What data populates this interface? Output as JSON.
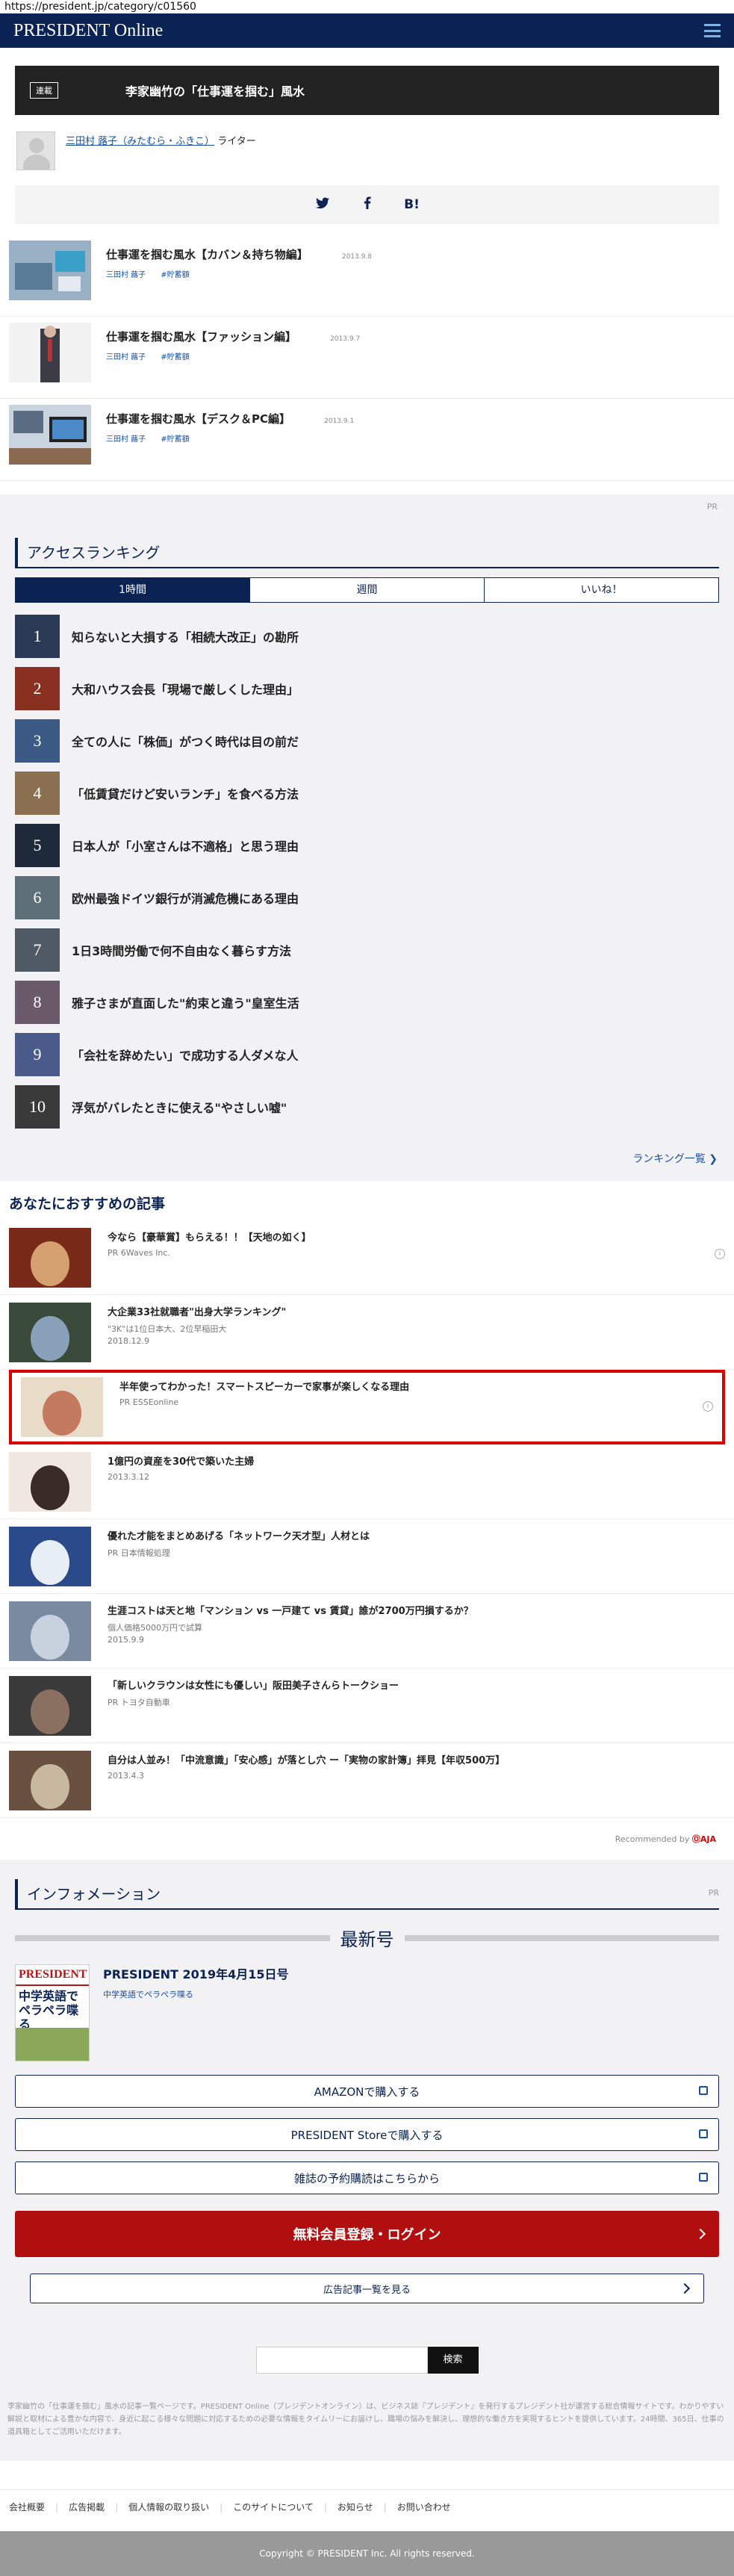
{
  "url": "https://president.jp/category/c01560",
  "header": {
    "logo": "PRESIDENT Online"
  },
  "serial": {
    "badge": "連載",
    "title": "李家幽竹の「仕事運を掴む」風水"
  },
  "author": {
    "name": "三田村 蕗子（みたむら・ふきこ）",
    "role": "ライター"
  },
  "share": {
    "twitter": "twitter-icon",
    "facebook": "facebook-icon",
    "hatena": "B!"
  },
  "related": [
    {
      "title": "仕事運を掴む風水【カバン＆持ち物編】",
      "date": "2013.9.8",
      "author": "三田村 蕗子",
      "tag": "#貯蓄額",
      "colors": [
        "#9ab0c4",
        "#5b7c99"
      ]
    },
    {
      "title": "仕事運を掴む風水【ファッション編】",
      "date": "2013.9.7",
      "author": "三田村 蕗子",
      "tag": "#貯蓄額",
      "colors": [
        "#e8e8e8",
        "#3c3c46"
      ]
    },
    {
      "title": "仕事運を掴む風水【デスク＆PC編】",
      "date": "2013.9.1",
      "author": "三田村 蕗子",
      "tag": "#貯蓄額",
      "colors": [
        "#5a6b82",
        "#c9d4df"
      ]
    }
  ],
  "pr_label": "PR",
  "ranking": {
    "title": "アクセスランキング",
    "tabs": [
      "1時間",
      "週間",
      "いいね！"
    ],
    "items": [
      {
        "rank": "1",
        "title": "知らないと大損する「相続大改正」の勘所",
        "color": "#2a3a55"
      },
      {
        "rank": "2",
        "title": "大和ハウス会長「現場で厳しくした理由」",
        "color": "#8a3020"
      },
      {
        "rank": "3",
        "title": "全ての人に「株価」がつく時代は目の前だ",
        "color": "#3c5a86"
      },
      {
        "rank": "4",
        "title": "「低賃貸だけど安いランチ」を食べる方法",
        "color": "#8a7050"
      },
      {
        "rank": "5",
        "title": "日本人が「小室さんは不適格」と思う理由",
        "color": "#1e2a3a"
      },
      {
        "rank": "6",
        "title": "欧州最強ドイツ銀行が消滅危機にある理由",
        "color": "#5f6f7a"
      },
      {
        "rank": "7",
        "title": "1日3時間労働で何不自由なく暮らす方法",
        "color": "#505a64"
      },
      {
        "rank": "8",
        "title": "雅子さまが直面した\"約束と違う\"皇室生活",
        "color": "#6b5a6a"
      },
      {
        "rank": "9",
        "title": "「会社を辞めたい」で成功する人ダメな人",
        "color": "#4a5a8a"
      },
      {
        "rank": "10",
        "title": "浮気がバレたときに使える\"やさしい嘘\"",
        "color": "#3a3a3a"
      }
    ],
    "more": "ランキング一覧 ❯"
  },
  "recommend": {
    "title": "あなたにおすすめの記事",
    "items": [
      {
        "title": "今なら【豪華賞】もらえる！！【天地の如く】",
        "sub": "PR 6Waves Inc.",
        "info": true,
        "highlight": false,
        "colors": [
          "#7a2a18",
          "#d4a070"
        ]
      },
      {
        "title": "大企業33社就職者\"出身大学ランキング\"",
        "sub": "\"3K\"は1位日本大、2位早稲田大",
        "sub2": "2018.12.9",
        "info": false,
        "highlight": false,
        "colors": [
          "#3a4a3a",
          "#88a0b8"
        ]
      },
      {
        "title": "半年使ってわかった！スマートスピーカーで家事が楽しくなる理由",
        "sub": "PR ESSEonline",
        "info": true,
        "highlight": true,
        "colors": [
          "#e8dcc8",
          "#c47a60"
        ]
      },
      {
        "title": "1億円の資産を30代で築いた主婦",
        "sub": "2013.3.12",
        "info": false,
        "highlight": false,
        "colors": [
          "#f0e8e0",
          "#3a2a28"
        ]
      },
      {
        "title": "優れた才能をまとめあげる「ネットワーク天才型」人材とは",
        "sub": "PR 日本情報処理",
        "info": false,
        "highlight": false,
        "colors": [
          "#2a4a8a",
          "#e8eef6"
        ]
      },
      {
        "title": "生涯コストは天と地「マンション vs 一戸建て vs 賃貸」誰が2700万円損するか？",
        "sub": "個人価格5000万円で試算",
        "sub2": "2015.9.9",
        "info": false,
        "highlight": false,
        "colors": [
          "#7a8aa0",
          "#c8d2de"
        ]
      },
      {
        "title": "「新しいクラウンは女性にも優しい」阪田美子さんらトークショー",
        "sub": "PR トヨタ自動車",
        "info": false,
        "highlight": false,
        "colors": [
          "#3a3a3a",
          "#8a7060"
        ]
      },
      {
        "title": "自分は人並み！「中流意識」「安心感」が落とし穴 ー「実物の家計簿」拝見【年収500万】",
        "sub": "2013.4.3",
        "info": false,
        "highlight": false,
        "colors": [
          "#6a5040",
          "#c8b8a0"
        ]
      }
    ],
    "recommended_by": "Recommended by",
    "recommended_brand": "ⓄAJA"
  },
  "information": {
    "title": "インフォメーション",
    "pr": "PR",
    "latest": "最新号",
    "issue_title": "PRESIDENT 2019年4月15日号",
    "issue_sub": "中学英語でペラペラ喋る",
    "cover_brand": "PRESIDENT",
    "cover_head": "中学英語でペラペラ喋る",
    "amazon": "AMAZONで購入する",
    "store": "PRESIDENT Storeで購入する",
    "subscribe": "雑誌の予約購読はこちらから",
    "register": "無料会員登録・ログイン",
    "ad_list": "広告記事一覧を見る"
  },
  "search": {
    "placeholder": "",
    "button": "検索"
  },
  "site_desc": "李家幽竹の「仕事運を掴む」風水の記事一覧ページです。PRESIDENT Online（プレジデントオンライン）は、ビジネス誌『プレジデント』を発行するプレジデント社が運営する総合情報サイトです。わかりやすい解説と取材による豊かな内容で、身近に起こる様々な問題に対応するための必要な情報をタイムリーにお届けし、職場の悩みを解決し、理想的な働き方を実現するヒントを提供しています。24時間、365日、仕事の道具箱としてご活用いただけます。",
  "footer": {
    "links": [
      "会社概要",
      "広告掲載",
      "個人情報の取り扱い",
      "このサイトについて",
      "お知らせ",
      "お問い合わせ"
    ],
    "copyright": "Copyright © PRESIDENT Inc. All rights reserved."
  }
}
